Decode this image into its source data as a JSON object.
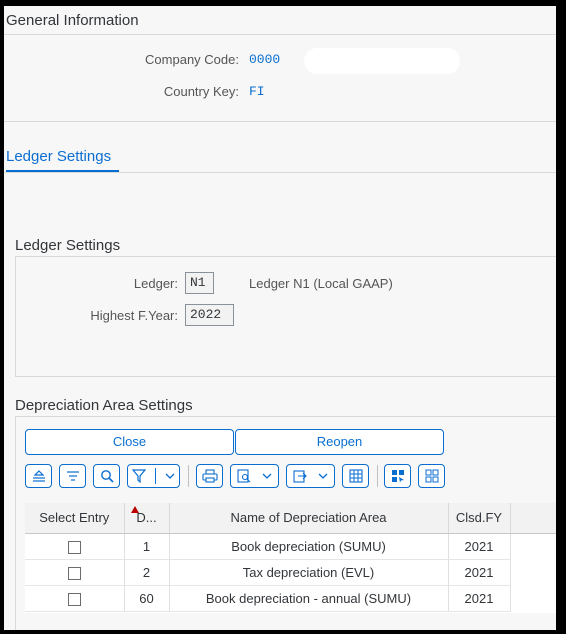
{
  "general": {
    "title": "General Information",
    "company_code_label": "Company Code:",
    "company_code_value": "0000",
    "country_key_label": "Country Key:",
    "country_key_value": "FI"
  },
  "tabs": [
    {
      "label": "Ledger Settings",
      "active": true
    }
  ],
  "ledger_settings": {
    "title": "Ledger Settings",
    "ledger_label": "Ledger:",
    "ledger_value": "N1",
    "ledger_desc": "Ledger N1 (Local GAAP)",
    "highest_fyear_label": "Highest F.Year:",
    "highest_fyear_value": "2022"
  },
  "depreciation": {
    "title": "Depreciation Area Settings",
    "close_label": "Close",
    "reopen_label": "Reopen",
    "toolbar_icons": [
      "collapse-icon",
      "filter-align-icon",
      "search-icon",
      "filter-funnel-icon",
      "print-icon",
      "print-preview-icon",
      "export-icon",
      "spreadsheet-icon",
      "layout-select-icon",
      "layout-grid-icon"
    ],
    "columns": [
      "Select Entry",
      "D...",
      "Name of Depreciation Area",
      "Clsd.FY"
    ],
    "rows": [
      {
        "selected": false,
        "area": "1",
        "name": "Book depreciation (SUMU)",
        "fy": "2021"
      },
      {
        "selected": false,
        "area": "2",
        "name": "Tax depreciation (EVL)",
        "fy": "2021"
      },
      {
        "selected": false,
        "area": "60",
        "name": "Book depreciation - annual (SUMU)",
        "fy": "2021"
      }
    ]
  },
  "colors": {
    "accent": "#0a6ed1",
    "sort_indicator": "#bb0000",
    "background": "#f7f7f7"
  }
}
